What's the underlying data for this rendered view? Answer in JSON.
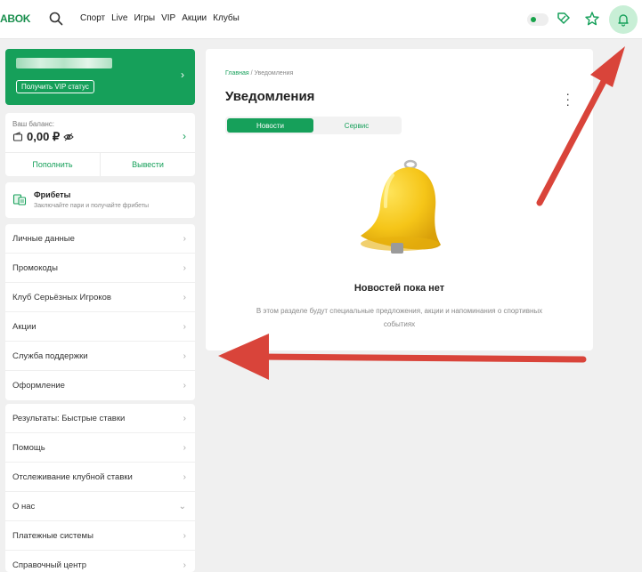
{
  "header": {
    "logo": "ABOK",
    "nav": [
      "Спорт",
      "Live",
      "Игры",
      "VIP",
      "Акции",
      "Клубы"
    ]
  },
  "vip": {
    "button_label": "Получить VIP статус"
  },
  "balance": {
    "label": "Ваш баланс:",
    "amount": "0,00 ₽",
    "deposit_label": "Пополнить",
    "withdraw_label": "Вывести"
  },
  "freebets": {
    "title": "Фрибеты",
    "subtitle": "Заключайте пари и получайте фрибеты"
  },
  "menu1": [
    "Личные данные",
    "Промокоды",
    "Клуб Серьёзных Игроков",
    "Акции",
    "Служба поддержки",
    "Оформление"
  ],
  "menu2": [
    "Результаты: Быстрые ставки",
    "Помощь",
    "Отслеживание клубной ставки",
    "О нас",
    "Платежные системы",
    "Справочный центр"
  ],
  "main": {
    "breadcrumb_home": "Главная",
    "breadcrumb_sep": " / ",
    "breadcrumb_current": "Уведомления",
    "title": "Уведомления",
    "tabs": [
      "Новости",
      "Сервис"
    ],
    "empty_title": "Новостей пока нет",
    "empty_desc": "В этом разделе будут специальные предложения, акции и напоминания о спортивных событиях"
  },
  "colors": {
    "accent": "#16a05a",
    "annotation": "#d9443a"
  }
}
